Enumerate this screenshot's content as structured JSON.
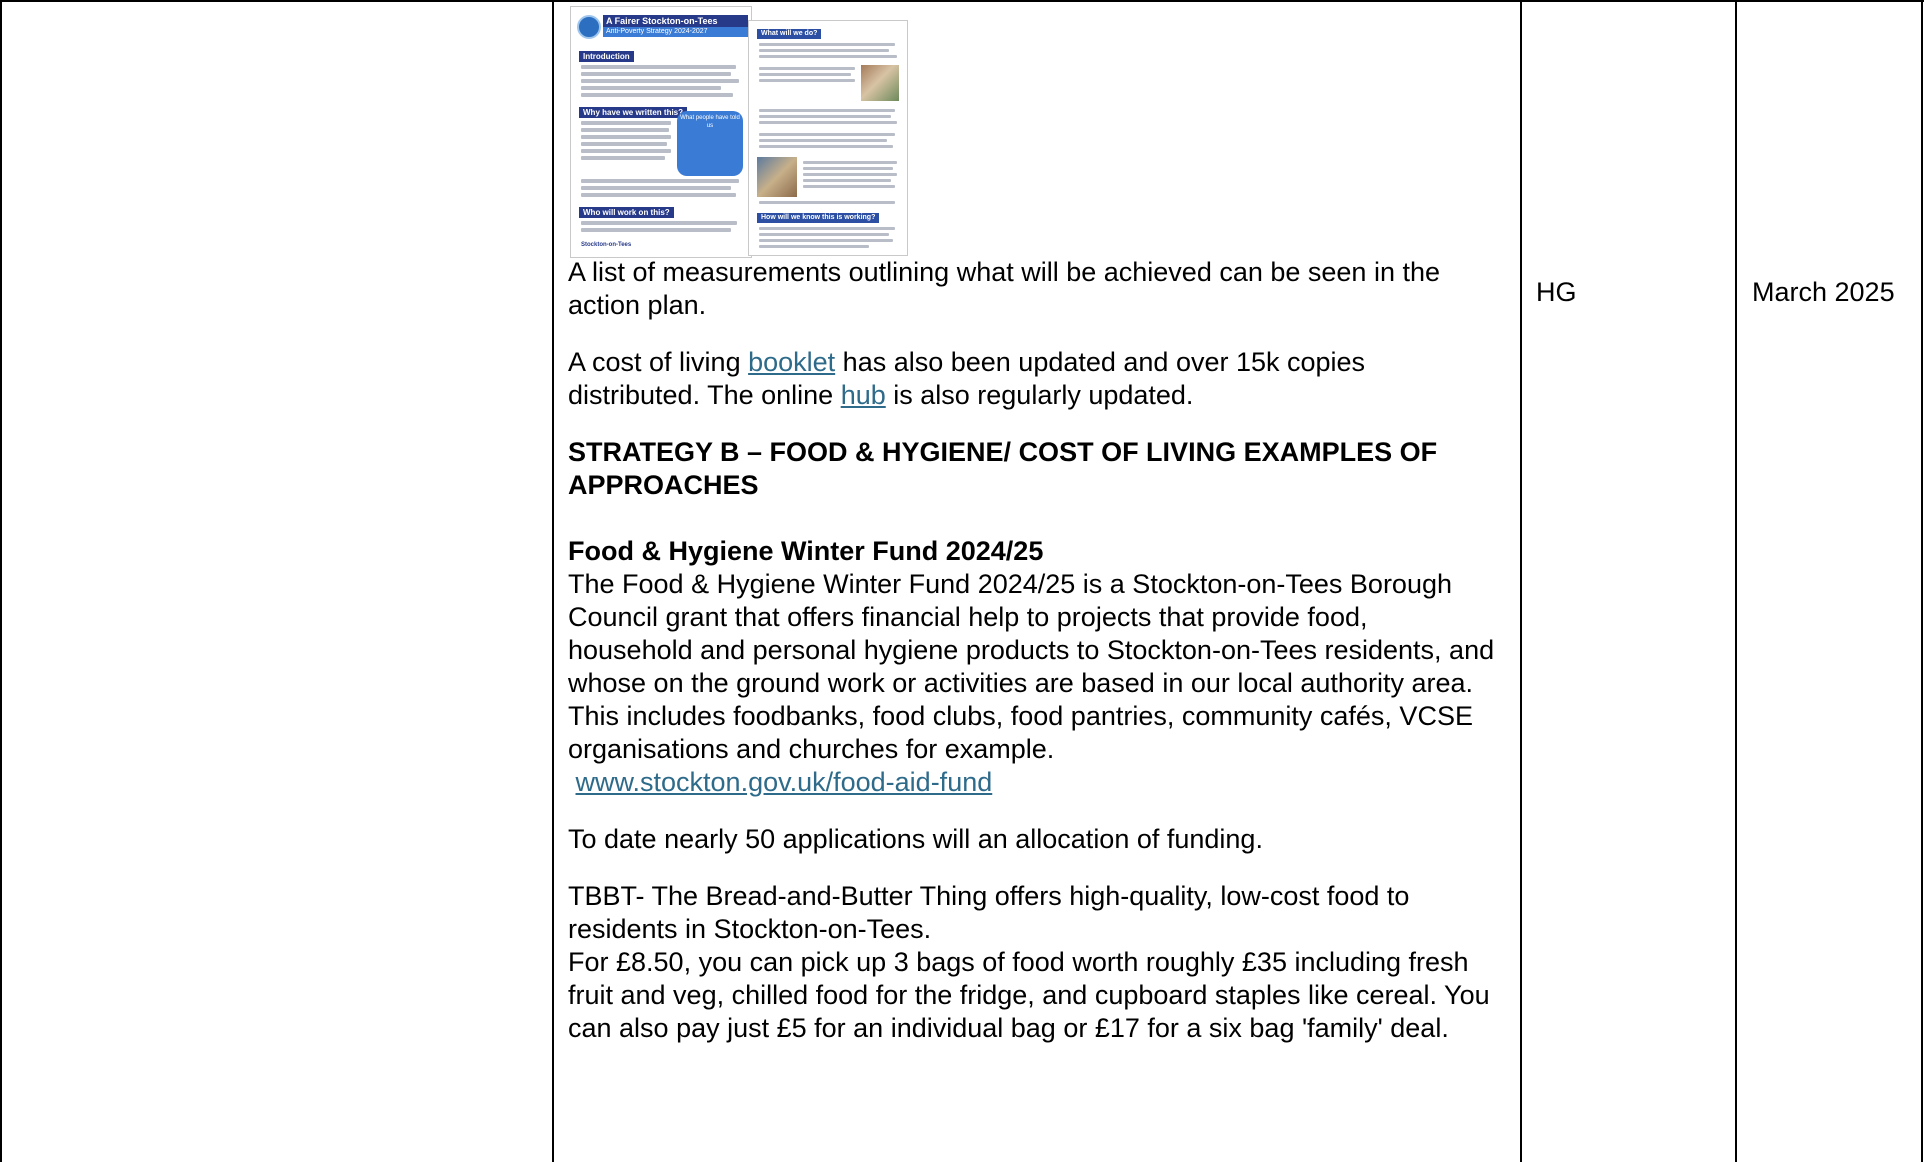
{
  "thumbnail_1": {
    "title": "A Fairer Stockton-on-Tees",
    "subtitle": "Anti-Poverty Strategy 2024-2027",
    "sections": [
      "Introduction",
      "Why have we written this?",
      "Who will work on this?"
    ],
    "callout": "What people have told us",
    "footer": "Stockton-on-Tees"
  },
  "thumbnail_2": {
    "sections": [
      "What will we do?",
      "How will we know this is working?"
    ]
  },
  "content": {
    "p1": "A list of measurements outlining what will be achieved can be seen in the action plan.",
    "p2_pre": "A cost of living ",
    "p2_link1": "booklet",
    "p2_mid": " has also been updated and over 15k copies distributed.  The online ",
    "p2_link2": "hub",
    "p2_post": " is also regularly updated.",
    "strategy_heading": "STRATEGY B – FOOD & HYGIENE/ COST OF LIVING EXAMPLES OF APPROACHES",
    "fund_heading": "Food & Hygiene Winter Fund 2024/25",
    "fund_body": "The Food & Hygiene Winter Fund 2024/25 is a Stockton-on-Tees Borough Council grant that offers financial help to projects that provide food, household and personal hygiene products to Stockton-on-Tees residents, and whose on the ground work or activities are based in our local authority area. This includes foodbanks, food clubs, food pantries, community cafés, VCSE organisations and churches for example.",
    "fund_link": "www.stockton.gov.uk/food-aid-fund",
    "applications": "To date nearly 50 applications will an allocation of funding.",
    "tbbt_1": "TBBT- The Bread-and-Butter Thing offers high-quality, low-cost food to residents in Stockton-on-Tees.",
    "tbbt_2": "For £8.50, you can pick up 3 bags of food worth roughly £35 including fresh fruit and veg, chilled food for the fridge, and cupboard staples like cereal. You can also pay just £5 for an individual bag or £17 for a six bag 'family' deal."
  },
  "lead": "HG",
  "date": "March 2025",
  "colors": {
    "link": "#2e6b8a",
    "thumbnail_header": "#273a8a"
  }
}
